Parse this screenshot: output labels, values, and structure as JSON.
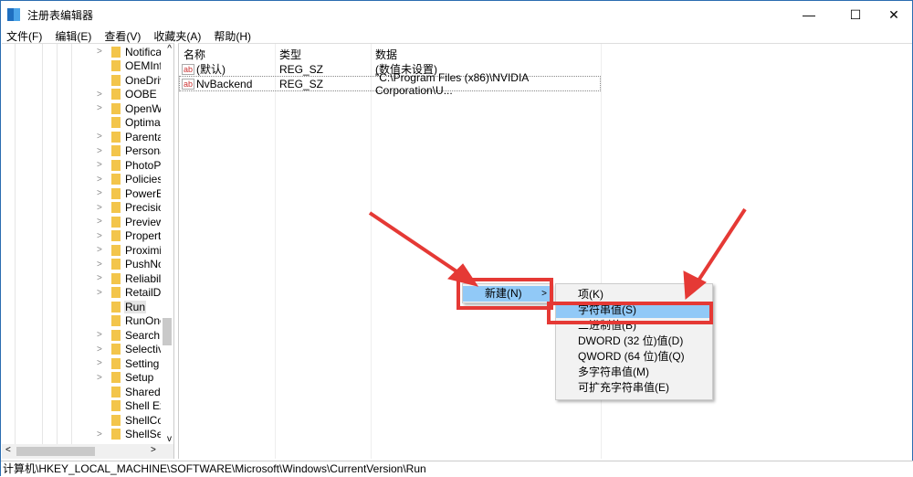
{
  "window": {
    "title": "注册表编辑器",
    "minimize": "—",
    "maximize": "☐",
    "close": "✕"
  },
  "menu": [
    "文件(F)",
    "编辑(E)",
    "查看(V)",
    "收藏夹(A)",
    "帮助(H)"
  ],
  "tree": [
    {
      "label": "Notifica",
      "exp": ">"
    },
    {
      "label": "OEMInfo",
      "exp": ""
    },
    {
      "label": "OneDriv",
      "exp": ""
    },
    {
      "label": "OOBE",
      "exp": ">"
    },
    {
      "label": "OpenW",
      "exp": ">"
    },
    {
      "label": "Optimal",
      "exp": ""
    },
    {
      "label": "Parenta",
      "exp": ">"
    },
    {
      "label": "Persona",
      "exp": ">"
    },
    {
      "label": "PhotoPr",
      "exp": ">"
    },
    {
      "label": "Policies",
      "exp": ">"
    },
    {
      "label": "PowerEi",
      "exp": ">"
    },
    {
      "label": "Precisio",
      "exp": ">"
    },
    {
      "label": "Preview",
      "exp": ">"
    },
    {
      "label": "Propert",
      "exp": ">"
    },
    {
      "label": "Proximi",
      "exp": ">"
    },
    {
      "label": "PushNo",
      "exp": ">"
    },
    {
      "label": "Reliabili",
      "exp": ">"
    },
    {
      "label": "RetailDe",
      "exp": ">"
    },
    {
      "label": "Run",
      "exp": "",
      "selected": true
    },
    {
      "label": "RunOnc",
      "exp": ""
    },
    {
      "label": "Search",
      "exp": ">"
    },
    {
      "label": "Selectiv",
      "exp": ">"
    },
    {
      "label": "Setting",
      "exp": ">"
    },
    {
      "label": "Setup",
      "exp": ">"
    },
    {
      "label": "SharedD",
      "exp": ""
    },
    {
      "label": "Shell Ex",
      "exp": ""
    },
    {
      "label": "ShellCo",
      "exp": ""
    },
    {
      "label": "ShellSer",
      "exp": ">"
    }
  ],
  "list": {
    "headers": [
      "名称",
      "类型",
      "数据"
    ],
    "rows": [
      {
        "name": "(默认)",
        "type": "REG_SZ",
        "data": "(数值未设置)"
      },
      {
        "name": "NvBackend",
        "type": "REG_SZ",
        "data": "\"C:\\Program Files (x86)\\NVIDIA Corporation\\U..."
      }
    ]
  },
  "context_menu": {
    "new": "新建(N)",
    "arrow": ">"
  },
  "submenu": [
    "项(K)",
    "字符串值(S)",
    "二进制值(B)",
    "DWORD (32 位)值(D)",
    "QWORD (64 位)值(Q)",
    "多字符串值(M)",
    "可扩充字符串值(E)"
  ],
  "status": "计算机\\HKEY_LOCAL_MACHINE\\SOFTWARE\\Microsoft\\Windows\\CurrentVersion\\Run",
  "colors": {
    "highlight": "#91c9f7",
    "annotation": "#e53935"
  }
}
